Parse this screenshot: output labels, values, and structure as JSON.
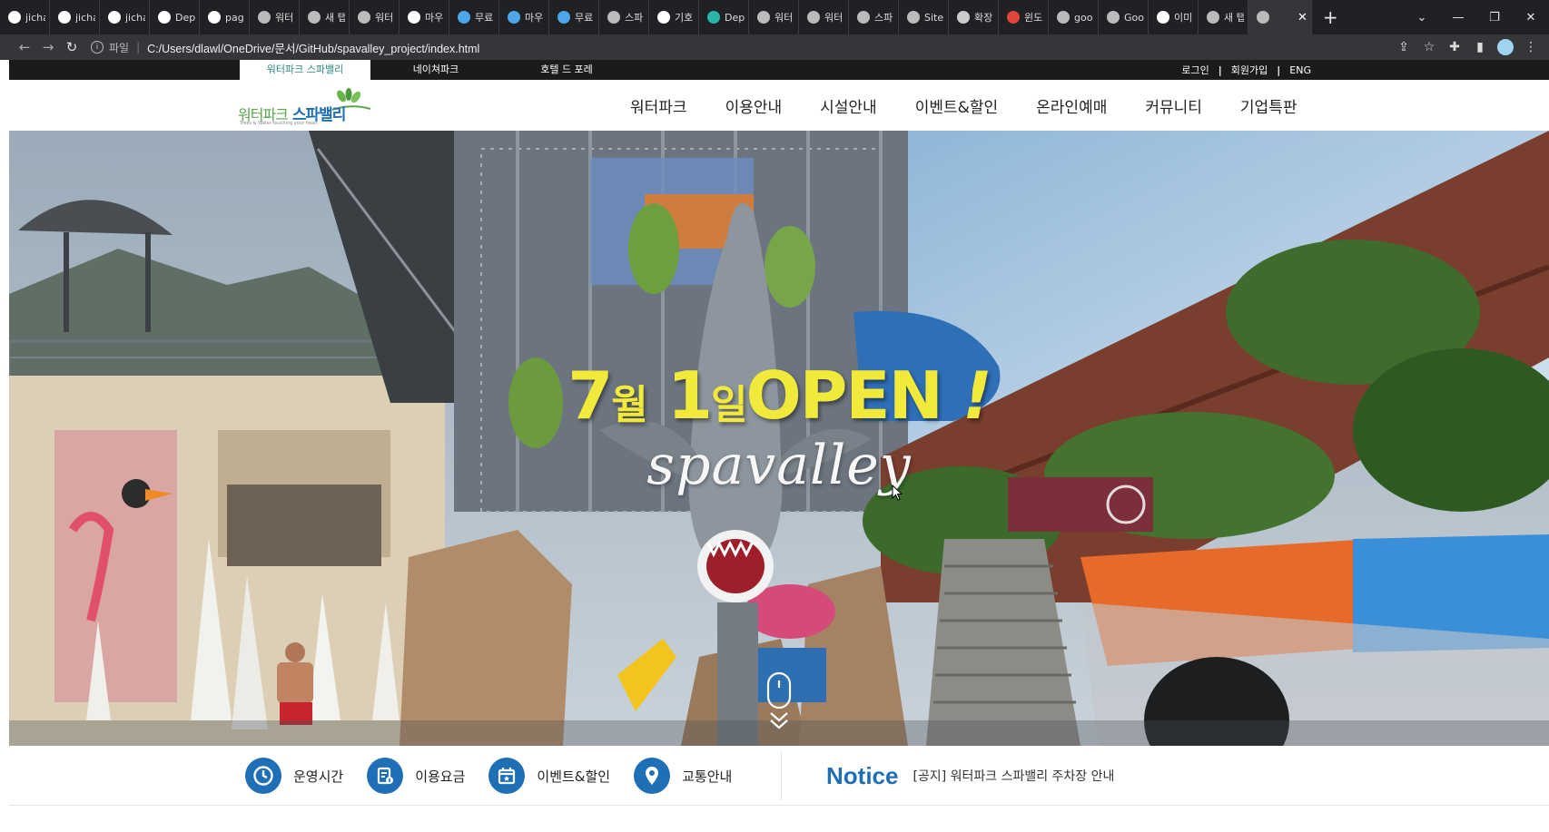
{
  "browser": {
    "tabs": [
      {
        "icon": "github-icon",
        "title": "jicha",
        "color": "#ffffff"
      },
      {
        "icon": "github-icon",
        "title": "jicha",
        "color": "#ffffff"
      },
      {
        "icon": "github-icon",
        "title": "jicha",
        "color": "#ffffff"
      },
      {
        "icon": "github-icon",
        "title": "Dep",
        "color": "#ffffff"
      },
      {
        "icon": "github-icon",
        "title": "pag",
        "color": "#ffffff"
      },
      {
        "icon": "globe-icon",
        "title": "워터",
        "color": "#bbbbbb"
      },
      {
        "icon": "globe-icon",
        "title": "새 탭",
        "color": "#bbbbbb"
      },
      {
        "icon": "globe-icon",
        "title": "워터",
        "color": "#bbbbbb"
      },
      {
        "icon": "google-icon",
        "title": "마우",
        "color": "#ffffff"
      },
      {
        "icon": "vue-icon",
        "title": "무료",
        "color": "#4ea5e8"
      },
      {
        "icon": "vue-icon",
        "title": "마우",
        "color": "#4ea5e8"
      },
      {
        "icon": "vue-icon",
        "title": "무료",
        "color": "#4ea5e8"
      },
      {
        "icon": "globe-icon",
        "title": "스파",
        "color": "#bbbbbb"
      },
      {
        "icon": "google-icon",
        "title": "기호",
        "color": "#ffffff"
      },
      {
        "icon": "diamond-icon",
        "title": "Dep",
        "color": "#29b6a8"
      },
      {
        "icon": "globe-icon",
        "title": "워터",
        "color": "#bbbbbb"
      },
      {
        "icon": "globe-icon",
        "title": "워터",
        "color": "#bbbbbb"
      },
      {
        "icon": "globe-icon",
        "title": "스파",
        "color": "#bbbbbb"
      },
      {
        "icon": "globe-icon",
        "title": "Site",
        "color": "#bbbbbb"
      },
      {
        "icon": "puzzle-icon",
        "title": "확장",
        "color": "#cccccc"
      },
      {
        "icon": "red-dot-icon",
        "title": "윈도",
        "color": "#e0443c"
      },
      {
        "icon": "globe-icon",
        "title": "goo",
        "color": "#bbbbbb"
      },
      {
        "icon": "globe-icon",
        "title": "Goo",
        "color": "#bbbbbb"
      },
      {
        "icon": "google-icon",
        "title": "이미",
        "color": "#ffffff"
      },
      {
        "icon": "globe-icon",
        "title": "새 탭",
        "color": "#bbbbbb"
      },
      {
        "icon": "globe-icon",
        "title": "",
        "color": "#bbbbbb",
        "active": true
      }
    ],
    "newtab": "+",
    "scheme": "파일",
    "url": "C:/Users/dlawl/OneDrive/문서/GitHub/spavalley_project/index.html"
  },
  "util": {
    "tabs": [
      "워터파크 스파밸리",
      "네이쳐파크",
      "호텔 드 포레"
    ],
    "links": [
      "로그인",
      "회원가입",
      "ENG"
    ]
  },
  "logo": {
    "line1_a": "워터파크",
    "line1_b": "스파밸리",
    "tagline": "Trees & Water touching your heart"
  },
  "nav": [
    "워터파크",
    "이용안내",
    "시설안내",
    "이벤트&할인",
    "온라인예매",
    "커뮤니티",
    "기업특판"
  ],
  "hero": {
    "h_num1": "7",
    "h_unit1": "월",
    "h_num2": "1",
    "h_unit2": "일",
    "h_word": "OPEN",
    "h_mark": "!",
    "script": "spavalley"
  },
  "quick": [
    {
      "icon": "clock-icon",
      "label": "운영시간"
    },
    {
      "icon": "fee-icon",
      "label": "이용요금"
    },
    {
      "icon": "calendar-icon",
      "label": "이벤트&할인"
    },
    {
      "icon": "map-pin-icon",
      "label": "교통안내"
    }
  ],
  "notice": {
    "title": "Notice",
    "text": "[공지] 워터파크 스파밸리 주차장 안내"
  }
}
